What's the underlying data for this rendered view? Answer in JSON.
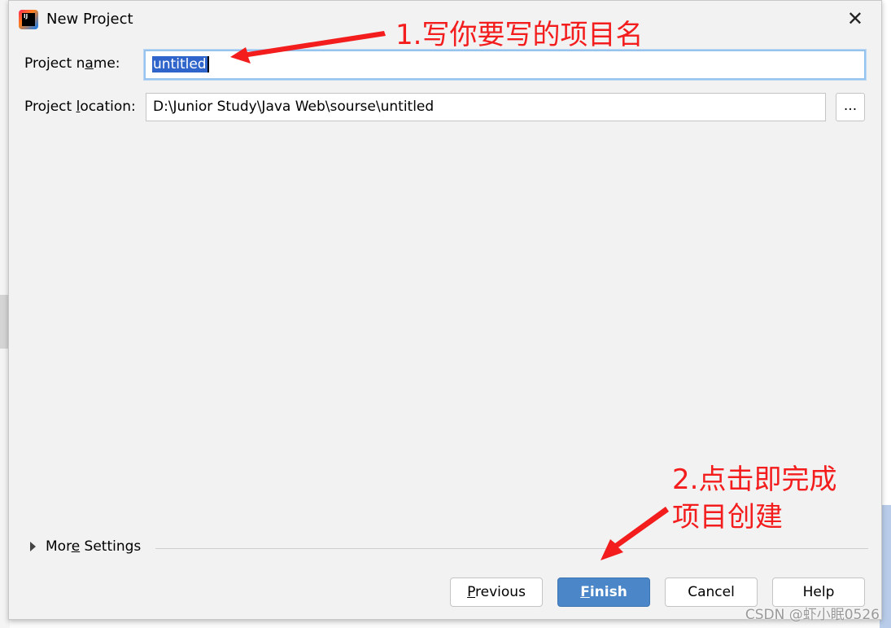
{
  "dialog": {
    "title": "New Project",
    "project_name_label_pre": "Project n",
    "project_name_label_u": "a",
    "project_name_label_post": "me:",
    "project_name_value": "untitled",
    "project_location_label_pre": "Project ",
    "project_location_label_u": "l",
    "project_location_label_post": "ocation:",
    "project_location_value": "D:\\Junior Study\\Java Web\\sourse\\untitled",
    "browse_label": "...",
    "more_settings_pre": "Mor",
    "more_settings_u": "e",
    "more_settings_post": " Settings",
    "buttons": {
      "previous_u": "P",
      "previous_rest": "revious",
      "finish_u": "F",
      "finish_rest": "inish",
      "cancel": "Cancel",
      "help": "Help"
    },
    "close_icon": "close-icon"
  },
  "annotations": {
    "step1": "1.写你要写的项目名",
    "step2_line1": "2.点击即完成",
    "step2_line2": "项目创建",
    "color": "#f31d1d"
  },
  "watermark": "CSDN @虾小眠0526",
  "colors": {
    "primary_button": "#4a86c8",
    "selection": "#2f65ca",
    "focus_border": "#97c3ef"
  }
}
